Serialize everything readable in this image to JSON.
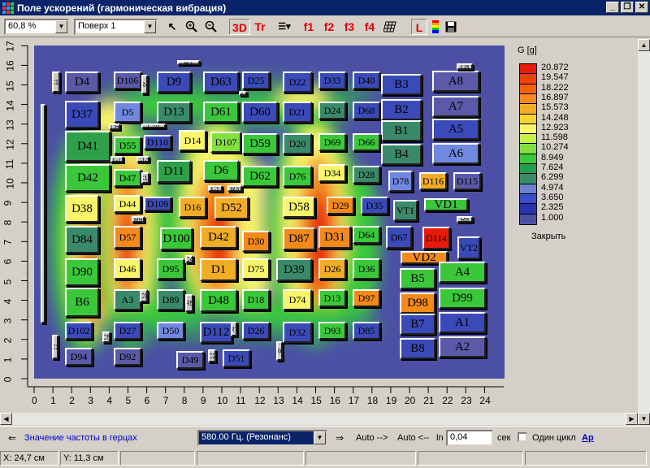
{
  "window": {
    "title": "Поле ускорений (гармоническая вибрация)"
  },
  "toolbar": {
    "zoom": "60,8 %",
    "layer": "Поверх 1",
    "btn_3d": "3D",
    "btn_tr": "Tr",
    "btn_f1": "f1",
    "btn_f2": "f2",
    "btn_f3": "f3",
    "btn_f4": "f4",
    "btn_l": "L"
  },
  "legend": {
    "title": "G [g]",
    "values": [
      "20.872",
      "19.547",
      "18.222",
      "16.897",
      "15.573",
      "14.248",
      "12.923",
      "11.598",
      "10.274",
      "8.949",
      "7.624",
      "6.299",
      "4.974",
      "3.650",
      "2.325",
      "1.000"
    ],
    "colors": [
      "#e81a0a",
      "#f0420a",
      "#f2620f",
      "#f38a1a",
      "#f2ad26",
      "#f5d530",
      "#f8f56a",
      "#c8f04a",
      "#82e040",
      "#3ac83a",
      "#22a050",
      "#3a8a6a",
      "#6a80d0",
      "#3a50c8",
      "#2832b0",
      "#4c50a5"
    ],
    "close_label": "Закрыть"
  },
  "axes": {
    "x_ticks": [
      "0",
      "1",
      "2",
      "3",
      "4",
      "5",
      "6",
      "7",
      "8",
      "9",
      "10",
      "11",
      "12",
      "13",
      "14",
      "15",
      "16",
      "17",
      "18",
      "19",
      "20",
      "21",
      "22",
      "23",
      "24"
    ],
    "y_ticks": [
      "0",
      "1",
      "2",
      "3",
      "4",
      "5",
      "6",
      "7",
      "8",
      "9",
      "10",
      "11",
      "12",
      "13",
      "14",
      "15",
      "16",
      "17"
    ]
  },
  "components": [
    {
      "label": "D4",
      "c": "#5a5aa8"
    },
    {
      "label": "D106",
      "c": "#5a5aa8"
    },
    {
      "label": "D9",
      "c": "#3a4ab8"
    },
    {
      "label": "D63",
      "c": "#3a4ab8"
    },
    {
      "label": "D25",
      "c": "#3a4ab8"
    },
    {
      "label": "D22",
      "c": "#3a4ab8"
    },
    {
      "label": "D33",
      "c": "#3a4ab8"
    },
    {
      "label": "D40",
      "c": "#3a4ab8"
    },
    {
      "label": "B3",
      "c": "#3a4ab8"
    },
    {
      "label": "A8",
      "c": "#5a5aa8"
    },
    {
      "label": "D37",
      "c": "#3a4ab8"
    },
    {
      "label": "D5",
      "c": "#7088e0"
    },
    {
      "label": "D13",
      "c": "#3a8a6a"
    },
    {
      "label": "D61",
      "c": "#3ac83a"
    },
    {
      "label": "D60",
      "c": "#3a4ab8"
    },
    {
      "label": "D21",
      "c": "#3a4ab8"
    },
    {
      "label": "D24",
      "c": "#3a8a6a"
    },
    {
      "label": "D68",
      "c": "#3a4ab8"
    },
    {
      "label": "B2",
      "c": "#3a4ab8"
    },
    {
      "label": "A7",
      "c": "#5a5aa8"
    },
    {
      "label": "B1",
      "c": "#3a8a6a"
    },
    {
      "label": "A5",
      "c": "#3a4ab8"
    },
    {
      "label": "D41",
      "c": "#2fa04a"
    },
    {
      "label": "D55",
      "c": "#3ac83a"
    },
    {
      "label": "D110",
      "c": "#3a4ab8"
    },
    {
      "label": "D14",
      "c": "#f8f56a"
    },
    {
      "label": "D107",
      "c": "#82e040"
    },
    {
      "label": "D59",
      "c": "#3ac83a"
    },
    {
      "label": "D20",
      "c": "#3a8a6a"
    },
    {
      "label": "D69",
      "c": "#3ac83a"
    },
    {
      "label": "D66",
      "c": "#3ac83a"
    },
    {
      "label": "B4",
      "c": "#3a8a6a"
    },
    {
      "label": "A6",
      "c": "#7088e0"
    },
    {
      "label": "D42",
      "c": "#3ac83a"
    },
    {
      "label": "D47",
      "c": "#3ac83a"
    },
    {
      "label": "D11",
      "c": "#2fa04a"
    },
    {
      "label": "D6",
      "c": "#3ac83a"
    },
    {
      "label": "D62",
      "c": "#3ac83a"
    },
    {
      "label": "D76",
      "c": "#3ac83a"
    },
    {
      "label": "D34",
      "c": "#f8f56a"
    },
    {
      "label": "D28",
      "c": "#3a8a6a"
    },
    {
      "label": "D78",
      "c": "#7088e0"
    },
    {
      "label": "D116",
      "c": "#f2ad26"
    },
    {
      "label": "D115",
      "c": "#5a5aa8"
    },
    {
      "label": "D38",
      "c": "#f8f56a"
    },
    {
      "label": "D44",
      "c": "#f8f56a"
    },
    {
      "label": "D109",
      "c": "#3a4ab8"
    },
    {
      "label": "D16",
      "c": "#f2ad26"
    },
    {
      "label": "D52",
      "c": "#f2ad26"
    },
    {
      "label": "D58",
      "c": "#f8f56a"
    },
    {
      "label": "D29",
      "c": "#f38a1a"
    },
    {
      "label": "D35",
      "c": "#3a4ab8"
    },
    {
      "label": "VT1",
      "c": "#3a8a6a"
    },
    {
      "label": "VD1",
      "c": "#3ac83a"
    },
    {
      "label": "D84",
      "c": "#3a8a6a"
    },
    {
      "label": "D57",
      "c": "#f38a1a"
    },
    {
      "label": "D100",
      "c": "#3ac83a"
    },
    {
      "label": "D42",
      "c": "#f2ad26"
    },
    {
      "label": "D30",
      "c": "#f38a1a"
    },
    {
      "label": "D87",
      "c": "#f38a1a"
    },
    {
      "label": "D31",
      "c": "#f38a1a"
    },
    {
      "label": "D64",
      "c": "#3ac83a"
    },
    {
      "label": "D67",
      "c": "#3a4ab8"
    },
    {
      "label": "D114",
      "c": "#e81a0a"
    },
    {
      "label": "VT2",
      "c": "#3a4ab8"
    },
    {
      "label": "VD2",
      "c": "#f38a1a"
    },
    {
      "label": "D90",
      "c": "#3ac83a"
    },
    {
      "label": "D46",
      "c": "#f8f56a"
    },
    {
      "label": "D95",
      "c": "#3ac83a"
    },
    {
      "label": "D1",
      "c": "#f2ad26"
    },
    {
      "label": "D75",
      "c": "#f8f56a"
    },
    {
      "label": "D39",
      "c": "#3a8a6a"
    },
    {
      "label": "D26",
      "c": "#f2ad26"
    },
    {
      "label": "D36",
      "c": "#3ac83a"
    },
    {
      "label": "B5",
      "c": "#3ac83a"
    },
    {
      "label": "A4",
      "c": "#3ac83a"
    },
    {
      "label": "B6",
      "c": "#3ac83a"
    },
    {
      "label": "A3",
      "c": "#3a8a6a"
    },
    {
      "label": "D89",
      "c": "#3a8a6a"
    },
    {
      "label": "D48",
      "c": "#3ac83a"
    },
    {
      "label": "D18",
      "c": "#3ac83a"
    },
    {
      "label": "D74",
      "c": "#f8f56a"
    },
    {
      "label": "D13",
      "c": "#3ac83a"
    },
    {
      "label": "D97",
      "c": "#f38a1a"
    },
    {
      "label": "D98",
      "c": "#f38a1a"
    },
    {
      "label": "D99",
      "c": "#3ac83a"
    },
    {
      "label": "B7",
      "c": "#3a4ab8"
    },
    {
      "label": "A1",
      "c": "#3a4ab8"
    },
    {
      "label": "D102",
      "c": "#3a4ab8"
    },
    {
      "label": "D27",
      "c": "#3a4ab8"
    },
    {
      "label": "D50",
      "c": "#7088e0"
    },
    {
      "label": "D112",
      "c": "#3a4ab8"
    },
    {
      "label": "D26",
      "c": "#3a4ab8"
    },
    {
      "label": "D32",
      "c": "#3a4ab8"
    },
    {
      "label": "D93",
      "c": "#3ac83a"
    },
    {
      "label": "D85",
      "c": "#3a4ab8"
    },
    {
      "label": "B8",
      "c": "#3a4ab8"
    },
    {
      "label": "A2",
      "c": "#5a5aa8"
    },
    {
      "label": "D94",
      "c": "#5a5aa8"
    },
    {
      "label": "D92",
      "c": "#5a5aa8"
    },
    {
      "label": "D49",
      "c": "#5a5aa8"
    },
    {
      "label": "D51",
      "c": "#3a4ab8"
    }
  ],
  "small_labels": [
    "C11",
    "R2",
    "R4",
    "R1",
    "C6",
    "C10",
    "C7",
    "C13",
    "C1",
    "R3",
    "C12",
    "R9",
    "R8",
    "C4",
    "C3",
    "C2",
    "R7",
    "R6",
    "C5",
    "R5",
    "C9",
    "C8"
  ],
  "bottom": {
    "freq_label": "Значение частоты в герцах",
    "freq_value": "580.00 Гц. (Резонанс)",
    "auto_fwd": "Auto -->",
    "auto_back": "Auto <--",
    "ln_label": "ln",
    "time_value": "0,04",
    "sec_label": "сек",
    "one_cycle_label": "Один цикл",
    "ap_label": "Ap"
  },
  "status": {
    "x": "X: 24,7 см",
    "y": "Y: 11,3 см"
  }
}
